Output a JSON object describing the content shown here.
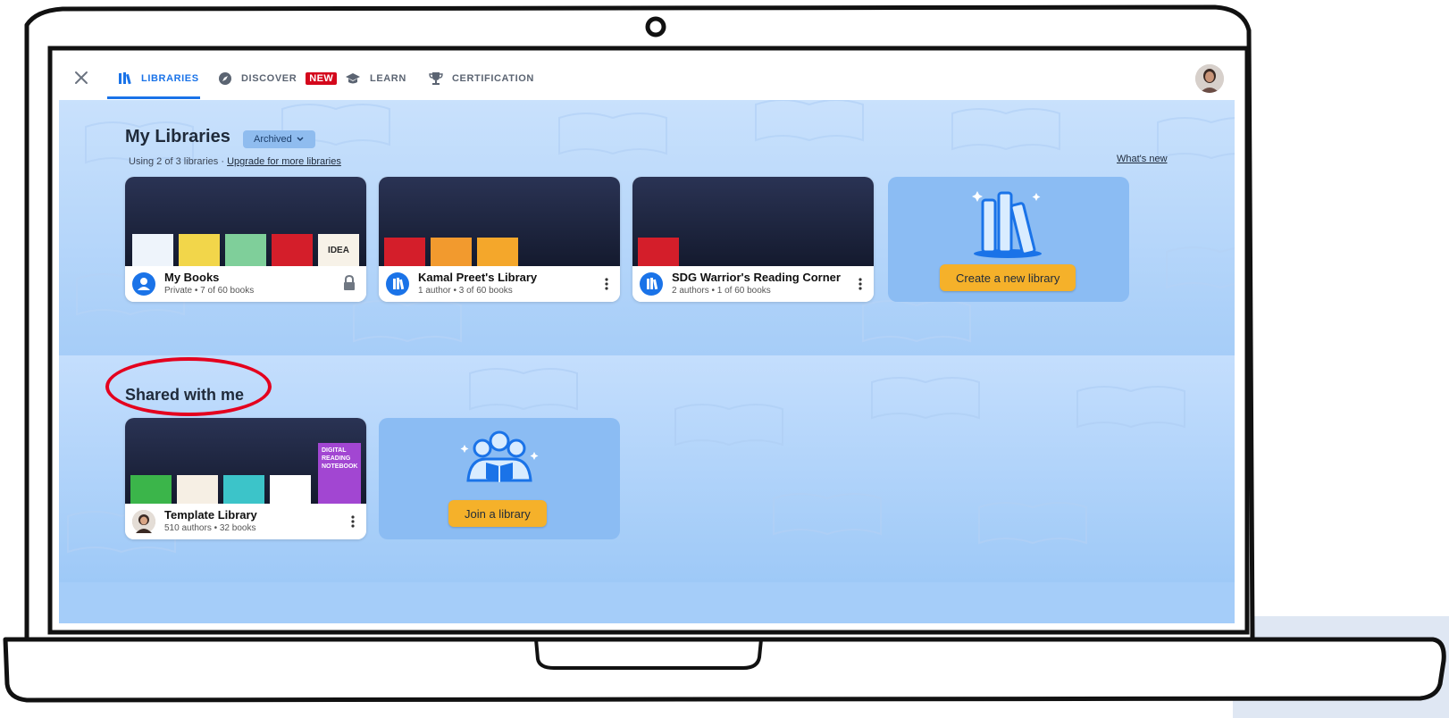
{
  "nav": {
    "close_icon": "close-icon",
    "items": [
      {
        "label": "LIBRARIES",
        "icon": "books-icon",
        "active": true
      },
      {
        "label": "DISCOVER",
        "icon": "compass-icon",
        "badge": "NEW"
      },
      {
        "label": "LEARN",
        "icon": "graduation-cap-icon"
      },
      {
        "label": "CERTIFICATION",
        "icon": "trophy-icon"
      }
    ],
    "avatar": "user-avatar"
  },
  "my_libraries": {
    "title": "My Libraries",
    "filter_label": "Archived",
    "usage_text": "Using 2 of 3 libraries",
    "upgrade_link": "Upgrade for more libraries",
    "whats_new_link": "What's new",
    "cards": [
      {
        "name": "My Books",
        "meta": "Private • 7 of 60 books",
        "icon": "person-icon",
        "action_icon": "lock-icon"
      },
      {
        "name": "Kamal Preet's Library",
        "meta": "1 author • 3 of 60 books",
        "icon": "books-icon",
        "action_icon": "kebab-icon"
      },
      {
        "name": "SDG Warrior's Reading Corner",
        "meta": "2 authors • 1 of 60 books",
        "icon": "books-icon",
        "action_icon": "kebab-icon"
      }
    ],
    "create_button": "Create a new library"
  },
  "shared": {
    "title": "Shared with me",
    "cards": [
      {
        "name": "Template Library",
        "meta": "510 authors • 32 books",
        "icon": "avatar",
        "action_icon": "kebab-icon"
      }
    ],
    "join_button": "Join a library"
  },
  "colors": {
    "accent": "#1a73e8",
    "badge": "#d4081c",
    "button": "#f5b12a",
    "highlight": "#e4001e"
  },
  "thumb_text": {
    "idea": "IDEA",
    "reading": "DIGITAL READING NOTEBOOK"
  }
}
